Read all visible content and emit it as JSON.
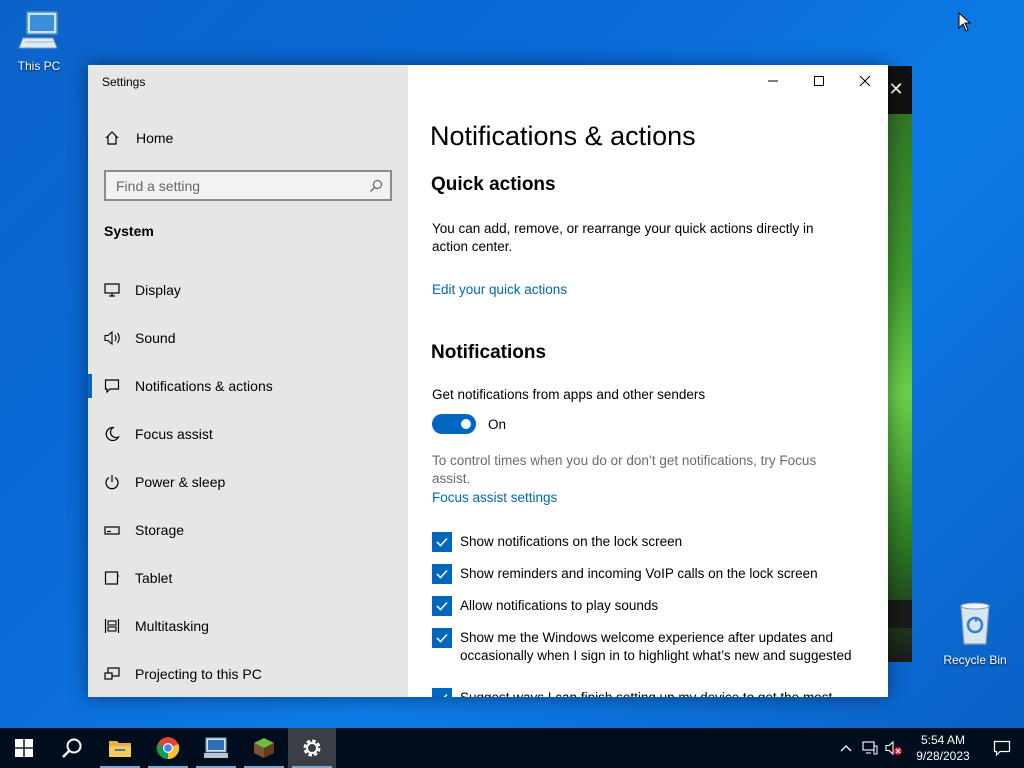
{
  "desktop": {
    "icons": [
      {
        "label": "This PC"
      },
      {
        "label": "Recycle Bin"
      }
    ]
  },
  "window": {
    "title": "Settings"
  },
  "sidebar": {
    "home_label": "Home",
    "search_placeholder": "Find a setting",
    "section_label": "System",
    "items": [
      {
        "label": "Display",
        "icon": "display-icon"
      },
      {
        "label": "Sound",
        "icon": "speaker-icon"
      },
      {
        "label": "Notifications & actions",
        "icon": "notification-icon",
        "active": true
      },
      {
        "label": "Focus assist",
        "icon": "moon-icon"
      },
      {
        "label": "Power & sleep",
        "icon": "power-icon"
      },
      {
        "label": "Storage",
        "icon": "storage-icon"
      },
      {
        "label": "Tablet",
        "icon": "tablet-icon"
      },
      {
        "label": "Multitasking",
        "icon": "multitasking-icon"
      },
      {
        "label": "Projecting to this PC",
        "icon": "projecting-icon"
      }
    ]
  },
  "content": {
    "page_title": "Notifications & actions",
    "quick_actions": {
      "heading": "Quick actions",
      "description": "You can add, remove, or rearrange your quick actions directly in action center.",
      "link": "Edit your quick actions"
    },
    "notifications": {
      "heading": "Notifications",
      "get_label": "Get notifications from apps and other senders",
      "toggle_state": "On",
      "toggle_on": true,
      "focus_desc": "To control times when you do or don’t get notifications, try Focus assist.",
      "focus_link": "Focus assist settings",
      "checkboxes": [
        {
          "label": "Show notifications on the lock screen",
          "checked": true
        },
        {
          "label": "Show reminders and incoming VoIP calls on the lock screen",
          "checked": true
        },
        {
          "label": "Allow notifications to play sounds",
          "checked": true
        },
        {
          "label": "Show me the Windows welcome experience after updates and occasionally when I sign in to highlight what’s new and suggested",
          "checked": true
        },
        {
          "label": "Suggest ways I can finish setting up my device to get the most",
          "checked": true
        }
      ]
    }
  },
  "taskbar": {
    "apps": [
      {
        "icon": "windows-start-icon"
      },
      {
        "icon": "search-icon"
      },
      {
        "icon": "file-explorer-icon"
      },
      {
        "icon": "chrome-icon"
      },
      {
        "icon": "remote-desktop-icon"
      },
      {
        "icon": "minecraft-icon"
      },
      {
        "icon": "settings-gear-icon",
        "active": true
      }
    ],
    "clock": {
      "time": "5:54 AM",
      "date": "9/28/2023"
    }
  },
  "colors": {
    "accent": "#0067c0",
    "link": "#0066b4",
    "sidebar_bg": "#e6e6e6",
    "taskbar_bg": "#000d1c"
  }
}
